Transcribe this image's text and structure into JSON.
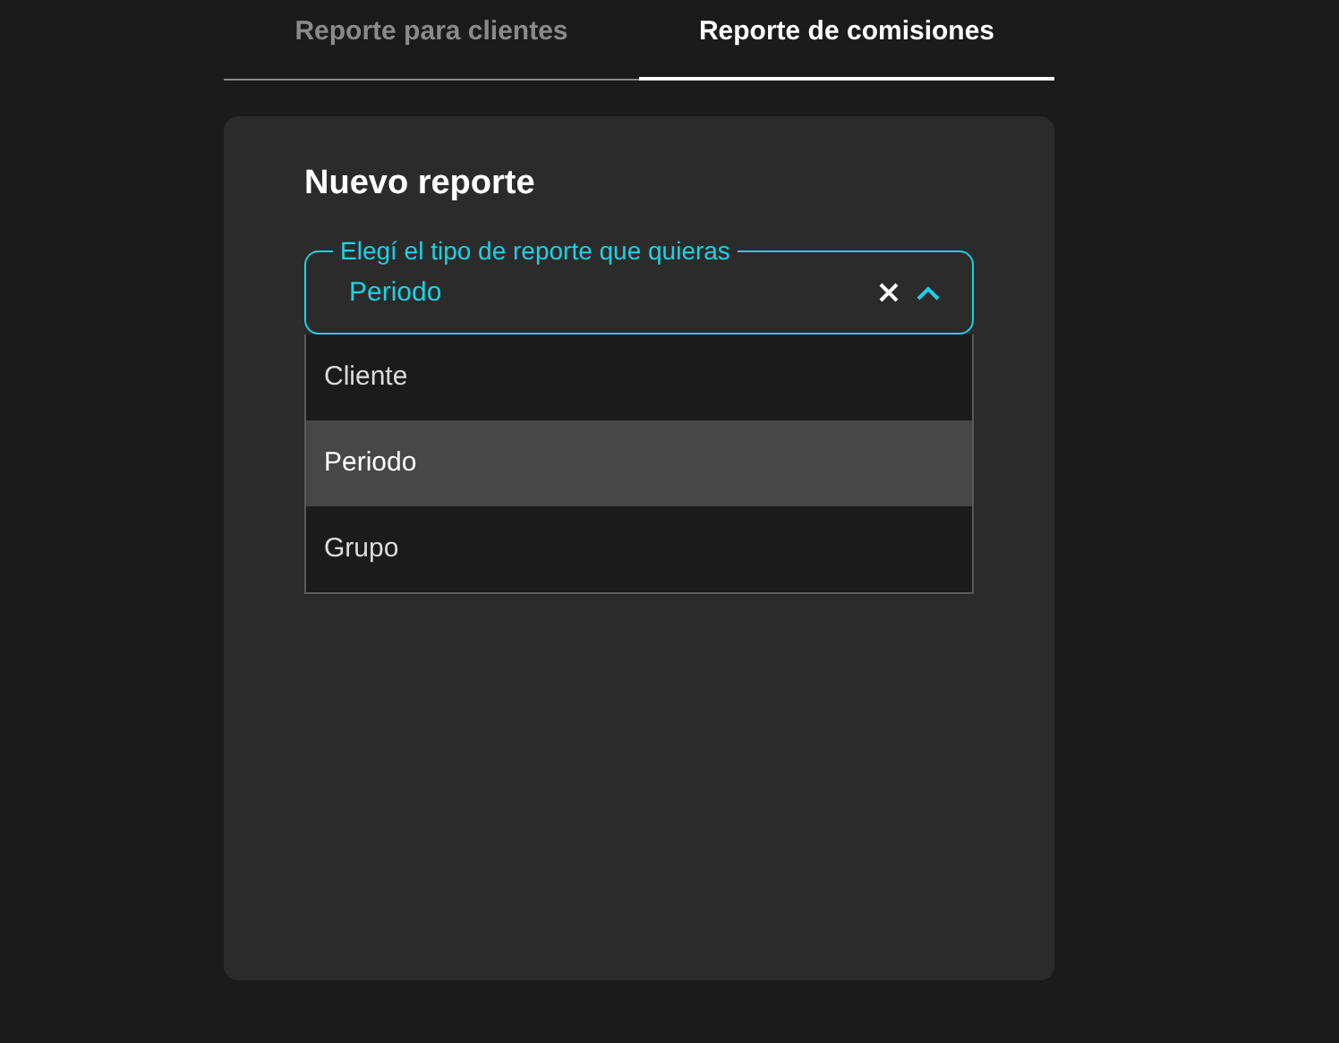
{
  "tabs": [
    {
      "label": "Reporte para clientes",
      "selected": false
    },
    {
      "label": "Reporte de comisiones",
      "selected": true
    }
  ],
  "card": {
    "title": "Nuevo reporte",
    "select": {
      "label": "Elegí el tipo de reporte que quieras",
      "value": "Periodo",
      "expanded": true,
      "options": [
        {
          "label": "Cliente",
          "selected": false
        },
        {
          "label": "Periodo",
          "selected": true
        },
        {
          "label": "Grupo",
          "selected": false
        }
      ]
    }
  }
}
